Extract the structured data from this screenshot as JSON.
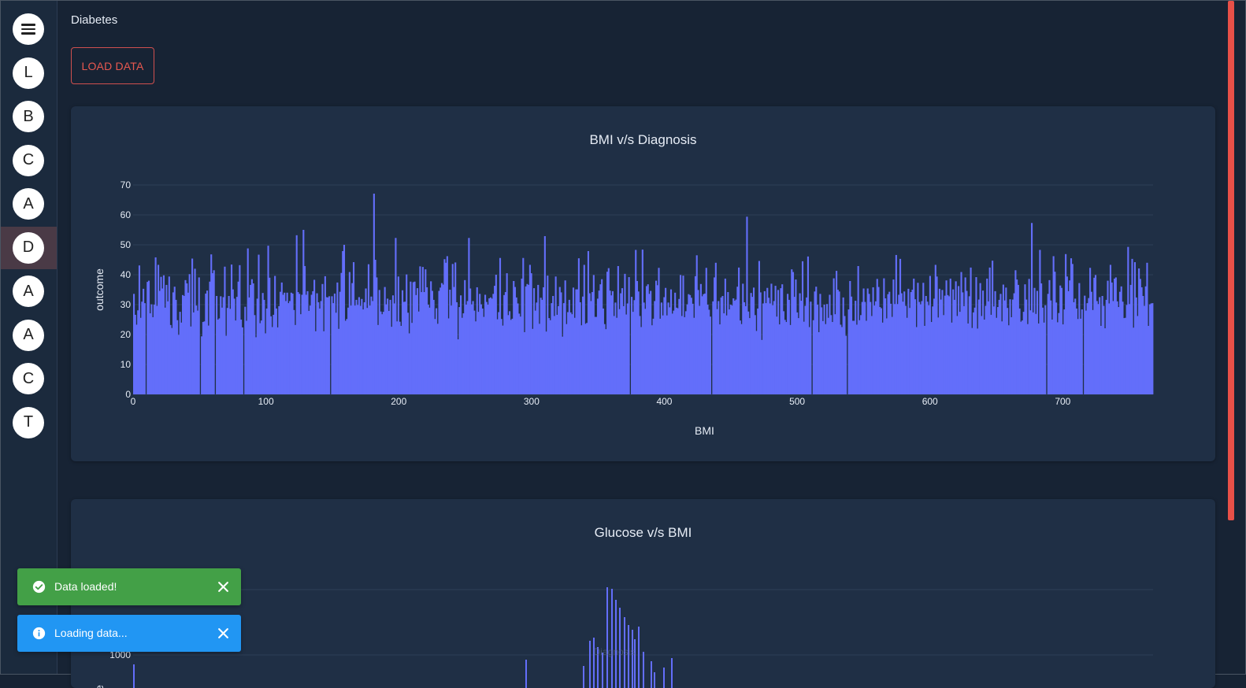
{
  "page": {
    "title": "Diabetes"
  },
  "nav": {
    "items": [
      {
        "label": "",
        "icon": "menu-icon"
      },
      {
        "label": "L"
      },
      {
        "label": "B"
      },
      {
        "label": "C"
      },
      {
        "label": "A"
      },
      {
        "label": "D",
        "active": true
      },
      {
        "label": "A"
      },
      {
        "label": "A"
      },
      {
        "label": "C"
      },
      {
        "label": "T"
      }
    ]
  },
  "toolbar": {
    "load_label": "LOAD DATA"
  },
  "chart_data": [
    {
      "type": "bar",
      "title": "BMI v/s Diagnosis",
      "xlabel": "BMI",
      "ylabel": "outcome",
      "xlim": [
        0,
        768
      ],
      "ylim": [
        0,
        70
      ],
      "xticks": [
        0,
        100,
        200,
        300,
        400,
        500,
        600,
        700
      ],
      "yticks": [
        0,
        10,
        20,
        30,
        40,
        50,
        60,
        70
      ],
      "grid": true,
      "color": "#636efa",
      "values": [
        33.6,
        26.6,
        23.3,
        28.1,
        43.1,
        25.6,
        31.0,
        35.3,
        30.5,
        0,
        37.6,
        38.0,
        27.1,
        30.1,
        25.8,
        30.0,
        45.8,
        29.6,
        43.3,
        34.6,
        39.3,
        35.4,
        39.8,
        29.0,
        36.6,
        31.1,
        39.4,
        23.2,
        22.2,
        34.1,
        36.0,
        31.6,
        24.8,
        19.9,
        27.6,
        24.0,
        33.2,
        32.9,
        38.2,
        37.1,
        34.0,
        40.2,
        22.7,
        45.4,
        27.4,
        42.0,
        29.7,
        28.0,
        39.1,
        0,
        19.4,
        24.2,
        24.4,
        33.7,
        34.7,
        23.0,
        37.7,
        46.8,
        40.5,
        41.5,
        0,
        32.9,
        25.0,
        25.4,
        32.8,
        29.0,
        32.5,
        42.7,
        19.6,
        28.9,
        32.9,
        28.6,
        43.4,
        35.1,
        32.0,
        24.7,
        32.6,
        37.7,
        43.2,
        25.0,
        22.4,
        0,
        29.3,
        24.6,
        48.8,
        32.4,
        36.6,
        38.5,
        37.1,
        26.5,
        19.1,
        32.0,
        46.7,
        23.8,
        24.7,
        33.9,
        31.6,
        20.4,
        28.7,
        49.7,
        39.0,
        26.1,
        22.5,
        26.6,
        39.6,
        28.7,
        22.4,
        29.5,
        34.3,
        37.4,
        33.3,
        34.0,
        31.2,
        34.0,
        30.5,
        31.2,
        34.0,
        33.7,
        28.2,
        23.2,
        53.2,
        34.2,
        33.6,
        26.8,
        33.3,
        55.0,
        42.9,
        33.3,
        34.5,
        27.9,
        29.7,
        33.3,
        34.5,
        38.3,
        21.1,
        33.8,
        30.8,
        28.7,
        31.2,
        36.9,
        21.1,
        39.5,
        32.5,
        32.4,
        32.8,
        0,
        32.8,
        30.5,
        33.7,
        27.3,
        37.4,
        21.9,
        34.3,
        40.6,
        47.9,
        50.0,
        24.6,
        25.2,
        29.0,
        40.9,
        29.7,
        37.2,
        44.2,
        29.7,
        31.6,
        29.9,
        32.5,
        29.6,
        31.9,
        28.4,
        30.8,
        35.4,
        28.9,
        43.5,
        29.7,
        32.7,
        31.2,
        67.1,
        45.0,
        39.1,
        23.2,
        34.9,
        27.7,
        26.8,
        27.6,
        35.9,
        30.1,
        32.0,
        27.9,
        31.6,
        22.6,
        33.1,
        30.4,
        52.3,
        24.4,
        39.4,
        24.3,
        22.9,
        34.8,
        30.9,
        31.0,
        40.1,
        27.3,
        20.4,
        37.7,
        23.9,
        37.5,
        37.7,
        33.2,
        35.5,
        27.7,
        42.8,
        34.2,
        42.6,
        34.2,
        41.8,
        35.8,
        30.0,
        29.0,
        37.8,
        34.6,
        31.6,
        25.2,
        28.8,
        23.6,
        34.6,
        35.7,
        37.2,
        36.7,
        45.2,
        44.0,
        46.2,
        25.4,
        35.0,
        29.7,
        43.6,
        35.9,
        44.1,
        30.8,
        18.4,
        29.2,
        33.1,
        25.6,
        27.1,
        38.2,
        30.0,
        31.2,
        52.3,
        35.4,
        30.1,
        31.2,
        28.0,
        24.4,
        35.8,
        27.6,
        33.6,
        30.1,
        28.7,
        25.9,
        33.3,
        30.9,
        30.0,
        32.1,
        32.4,
        32.0,
        33.6,
        36.3,
        40.0,
        25.1,
        27.5,
        45.6,
        25.2,
        23.0,
        33.2,
        34.2,
        40.5,
        26.5,
        27.8,
        24.9,
        25.3,
        37.9,
        35.9,
        32.4,
        30.4,
        27.0,
        26.0,
        38.7,
        45.6,
        20.8,
        36.1,
        36.9,
        36.6,
        43.3,
        40.5,
        21.9,
        35.5,
        28.0,
        30.7,
        36.6,
        23.6,
        32.3,
        31.6,
        35.8,
        52.9,
        21.0,
        39.7,
        25.5,
        24.8,
        30.5,
        32.9,
        26.2,
        39.4,
        26.6,
        29.5,
        35.9,
        34.1,
        19.3,
        30.5,
        38.1,
        23.5,
        27.5,
        31.6,
        27.4,
        26.8,
        35.7,
        25.6,
        35.1,
        35.1,
        45.5,
        30.8,
        23.1,
        32.7,
        43.3,
        23.6,
        23.9,
        47.9,
        33.8,
        31.2,
        34.2,
        39.9,
        25.9,
        25.9,
        32.0,
        34.7,
        36.8,
        38.5,
        28.7,
        23.5,
        21.8,
        41.0,
        42.2,
        34.7,
        33.1,
        34.5,
        26.2,
        30.7,
        25.6,
        42.9,
        28.5,
        33.8,
        35.5,
        29.5,
        40.3,
        26.7,
        30.4,
        39.2,
        0,
        32.6,
        27.6,
        31.5,
        48.3,
        37.9,
        34.4,
        26.2,
        22.5,
        48.4,
        30.7,
        28.6,
        36.2,
        36.8,
        33.6,
        34.6,
        23.1,
        25.3,
        31.2,
        38.0,
        36.5,
        42.3,
        25.3,
        30.7,
        26.4,
        32.5,
        35.6,
        26.4,
        30.7,
        29.1,
        35.1,
        27.0,
        28.0,
        34.0,
        29.0,
        28.8,
        31.9,
        39.9,
        26.2,
        39.7,
        25.8,
        27.8,
        30.1,
        33.5,
        33.2,
        32.3,
        30.3,
        25.6,
        39.5,
        46.5,
        34.9,
        29.6,
        36.9,
        32.8,
        33.5,
        33.7,
        42.3,
        30.0,
        28.3,
        26.0,
        0,
        31.1,
        39.1,
        44.0,
        28.5,
        31.2,
        23.4,
        32.4,
        32.9,
        27.1,
        38.7,
        26.4,
        34.2,
        28.4,
        30.0,
        29.7,
        32.1,
        31.3,
        31.7,
        36.0,
        42.4,
        24.7,
        23.5,
        37.0,
        30.8,
        29.5,
        59.4,
        27.7,
        25.5,
        33.9,
        32.6,
        35.7,
        26.5,
        21.2,
        28.7,
        44.6,
        34.1,
        18.2,
        30.4,
        34.5,
        30.5,
        35.6,
        32.3,
        30.4,
        37.0,
        29.8,
        31.2,
        36.3,
        26.0,
        34.9,
        23.4,
        35.5,
        36.8,
        27.8,
        24.9,
        24.2,
        33.6,
        31.6,
        23.2,
        41.8,
        40.9,
        32.6,
        38.4,
        27.4,
        25.5,
        33.8,
        31.3,
        44.5,
        24.3,
        29.6,
        32.4,
        46.1,
        22.5,
        31.0,
        0,
        24.8,
        34.4,
        36.0,
        30.0,
        20.8,
        33.6,
        29.1,
        24.5,
        30.0,
        23.5,
        30.2,
        25.6,
        33.3,
        26.5,
        24.2,
        38.8,
        26.8,
        41.3,
        35.0,
        34.4,
        23.3,
        22.5,
        32.4,
        26.2,
        19.6,
        0,
        28.4,
        37.9,
        32.7,
        24.6,
        24.6,
        31.3,
        23.3,
        42.9,
        24.8,
        26.5,
        30.9,
        35.4,
        30.9,
        24.6,
        35.4,
        33.6,
        30.9,
        26.2,
        35.8,
        29.7,
        31.1,
        38.6,
        35.9,
        29.2,
        28.8,
        24.0,
        38.8,
        32.1,
        25.4,
        33.5,
        34.3,
        30.3,
        25.9,
        38.4,
        30.2,
        46.6,
        30.2,
        33.3,
        45.3,
        33.8,
        31.0,
        34.4,
        29.6,
        25.6,
        35.3,
        28.9,
        34.2,
        35.0,
        38.7,
        31.8,
        22.5,
        37.3,
        30.9,
        30.1,
        31.2,
        37.3,
        22.9,
        32.9,
        31.0,
        29.8,
        39.6,
        24.2,
        29.4,
        32.0,
        43.3,
        39.4,
        25.7,
        35.3,
        31.7,
        34.9,
        26.5,
        33.0,
        38.1,
        33.2,
        32.8,
        38.7,
        24.0,
        35.1,
        31.6,
        37.8,
        26.2,
        36.2,
        27.6,
        40.9,
        34.1,
        29.5,
        39.1,
        34.6,
        23.7,
        32.8,
        42.4,
        22.2,
        27.4,
        29.0,
        39.2,
        22.0,
        31.7,
        37.2,
        26.2,
        34.7,
        25.0,
        29.6,
        38.7,
        31.1,
        42.4,
        26.6,
        44.7,
        29.4,
        34.5,
        25.6,
        29.2,
        31.6,
        33.6,
        24.4,
        36.7,
        31.4,
        35.7,
        28.9,
        23.1,
        31.8,
        25.8,
        31.7,
        33.8,
        41.5,
        38.4,
        36.6,
        28.7,
        24.3,
        24.7,
        27.6,
        36.8,
        31.7,
        23.5,
        38.6,
        28.1,
        57.3,
        27.4,
        35.6,
        26.9,
        34.6,
        23.7,
        48.3,
        37.1,
        29.0,
        24.0,
        29.8,
        0,
        33.6,
        38.2,
        31.4,
        25.0,
        46.2,
        41.0,
        30.7,
        24.1,
        27.2,
        36.4,
        35.6,
        23.4,
        28.4,
        46.9,
        39.4,
        34.5,
        38.1,
        45.5,
        43.6,
        30.8,
        32.0,
        28.7,
        25.2,
        37.2,
        25.3,
        28.4,
        0,
        33.0,
        28.0,
        30.5,
        32.2,
        42.3,
        34.3,
        28.2,
        39.0,
        39.9,
        31.2,
        30.2,
        32.5,
        22.9,
        32.9,
        29.6,
        22.1,
        31.6,
        38.0,
        30.4,
        43.3,
        37.4,
        31.2,
        38.7,
        39.1,
        31.1,
        29.2,
        34.3,
        36.1,
        31.0,
        25.5,
        25.6,
        29.9,
        49.3,
        30.2,
        36.6,
        45.3,
        22.3,
        44.2,
        32.4,
        26.2,
        42.1,
        38.6,
        35.8,
        32.9,
        29.6,
        36.1,
        44.0,
        22.9,
        30.1,
        30.4,
        30.5
      ]
    },
    {
      "type": "bar",
      "title": "Glucose v/s BMI",
      "yticks": [
        1000
      ],
      "color": "#636efa"
    }
  ],
  "watermark": {
    "text": "Diagnosis"
  },
  "toasts": [
    {
      "kind": "success",
      "message": "Data loaded!"
    },
    {
      "kind": "info",
      "message": "Loading data..."
    }
  ]
}
